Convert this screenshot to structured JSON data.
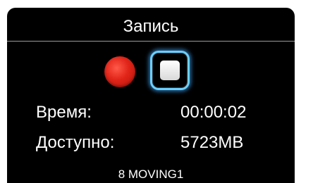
{
  "header": {
    "title": "Запись"
  },
  "controls": {
    "record_color": "#e02418",
    "stop_focus_color": "#6ad0ff"
  },
  "info": {
    "time_label": "Время:",
    "time_value": "00:00:02",
    "available_label": "Доступно:",
    "available_value": "5723MB"
  },
  "footer": {
    "text": "8 MOVING1"
  }
}
